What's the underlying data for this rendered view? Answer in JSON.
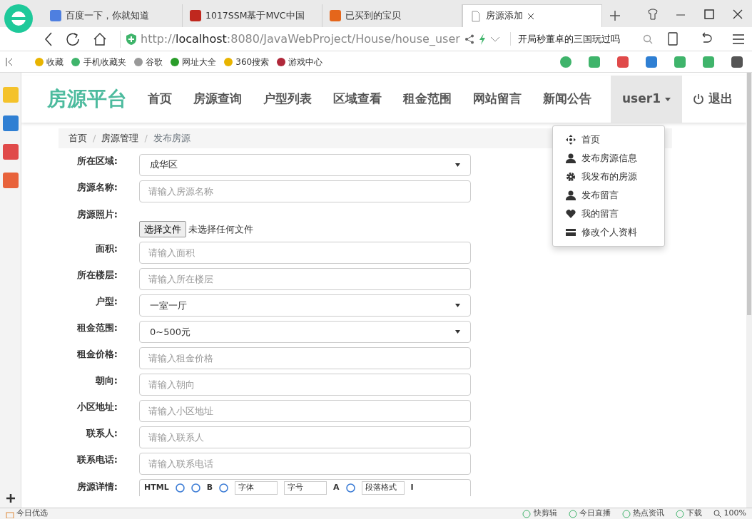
{
  "browser": {
    "tabs": [
      {
        "title": "百度一下，你就知道",
        "selected": false
      },
      {
        "title": "1017SSM基于MVC中国",
        "selected": false
      },
      {
        "title": "已买到的宝贝",
        "selected": false
      },
      {
        "title": "房源添加",
        "selected": true
      }
    ],
    "address": {
      "scheme": "http://",
      "host": "localhost",
      "path": ":8080/JavaWebProject/House/house_user"
    },
    "search": {
      "value": "开局秒董卓的三国玩过吗"
    },
    "bookmarks": [
      "收藏",
      "手机收藏夹",
      "谷歌",
      "网址大全",
      "360搜索",
      "游戏中心"
    ],
    "status_bar": {
      "left": "今日优选",
      "items": [
        "快剪辑",
        "今日直播",
        "热点资讯",
        "下载"
      ],
      "zoom": "100%"
    }
  },
  "navbar": {
    "brand": "房源平台",
    "links": [
      "首页",
      "房源查询",
      "户型列表",
      "区域查看",
      "租金范围",
      "网站留言",
      "新闻公告"
    ],
    "user_menu": {
      "label": "user1",
      "expanded": true,
      "items": [
        "首页",
        "发布房源信息",
        "我发布的房源",
        "发布留言",
        "我的留言",
        "修改个人资料"
      ]
    },
    "logout": "退出"
  },
  "breadcrumb": {
    "separator": "/",
    "items": [
      {
        "label": "首页",
        "link": true
      },
      {
        "label": "房源管理",
        "link": true
      },
      {
        "label": "发布房源",
        "link": false
      }
    ]
  },
  "form": {
    "fields": [
      {
        "kind": "select",
        "label": "所在区域:",
        "value": "成华区"
      },
      {
        "kind": "input",
        "label": "房源名称:",
        "placeholder": "请输入房源名称"
      },
      {
        "kind": "file",
        "label": "房源照片:",
        "button": "选择文件",
        "status": "未选择任何文件"
      },
      {
        "kind": "input",
        "label": "面积:",
        "placeholder": "请输入面积"
      },
      {
        "kind": "input",
        "label": "所在楼层:",
        "placeholder": "请输入所在楼层"
      },
      {
        "kind": "select",
        "label": "户型:",
        "value": "一室一厅"
      },
      {
        "kind": "select",
        "label": "租金范围:",
        "value": "0~500元"
      },
      {
        "kind": "input",
        "label": "租金价格:",
        "placeholder": "请输入租金价格"
      },
      {
        "kind": "input",
        "label": "朝向:",
        "placeholder": "请输入朝向"
      },
      {
        "kind": "input",
        "label": "小区地址:",
        "placeholder": "请输入小区地址"
      },
      {
        "kind": "input",
        "label": "联系人:",
        "placeholder": "请输入联系人"
      },
      {
        "kind": "input",
        "label": "联系电话:",
        "placeholder": "请输入联系电话"
      },
      {
        "kind": "editor",
        "label": "房源详情:",
        "toolbar": [
          {
            "kind": "text",
            "label": "HTML"
          },
          {
            "kind": "icon"
          },
          {
            "kind": "icon"
          },
          {
            "kind": "text",
            "label": "B"
          },
          {
            "kind": "icon"
          },
          {
            "kind": "select",
            "label": "字体"
          },
          {
            "kind": "select",
            "label": "字号"
          },
          {
            "kind": "text",
            "label": "A"
          },
          {
            "kind": "icon"
          },
          {
            "kind": "select",
            "label": "段落格式"
          },
          {
            "kind": "text",
            "label": "I"
          }
        ]
      }
    ]
  }
}
